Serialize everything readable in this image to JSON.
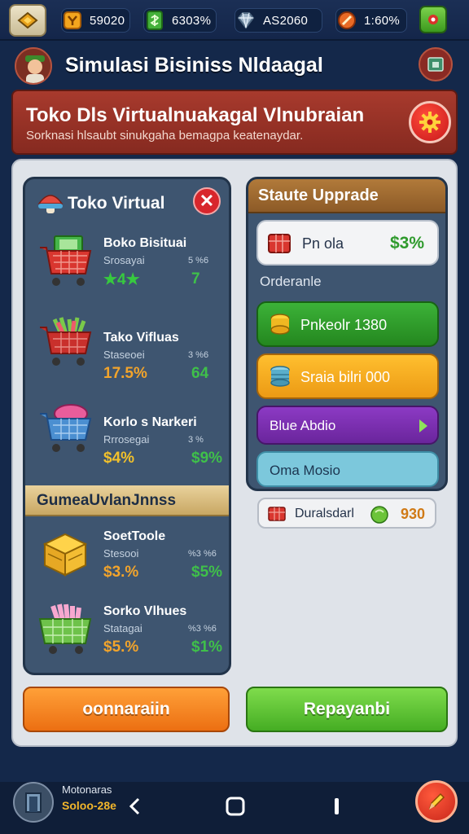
{
  "topbar": {
    "stats": [
      {
        "icon": "trophy-icon",
        "value": "59020"
      },
      {
        "icon": "cash-icon",
        "value": "6303%"
      },
      {
        "icon": "gem-icon",
        "value": "AS2060"
      },
      {
        "icon": "rocket-icon",
        "value": "1:60%"
      }
    ]
  },
  "header": {
    "title": "Simulasi Bisiniss Nldaagal"
  },
  "banner": {
    "title": "Toko Dls Virtualnuakagal Vlnubraian",
    "subtitle": "Sorknasi hlsaubt sinukgaha bemagpa keatenaydar."
  },
  "store_panel": {
    "title": "Toko Virtual",
    "close_label": "✕",
    "items": [
      {
        "name": "Boko Bisituai",
        "sub": "Srosayai",
        "small": "5 %6",
        "v1": "★4★",
        "v2": "7",
        "v1_color": "#37c93f"
      },
      {
        "name": "Tako Vifluas",
        "sub": "Staseoei",
        "small": "3 %6",
        "v1": "17.5%",
        "v2": "64",
        "v1_color": "#f2a42b"
      },
      {
        "name": "Korlo s Narkeri",
        "sub": "Rrrosegai",
        "small": "3 %",
        "v1": "$4%",
        "v2": "$9%",
        "v1_color": "#f2c12b"
      }
    ],
    "section_title": "GumeaUvlanJnnss",
    "section_items": [
      {
        "name": "SoetToole",
        "sub": "Stesooi",
        "small": "%3 %6",
        "v1": "$3.%",
        "v2": "$5%",
        "v1_color": "#f2a42b"
      },
      {
        "name": "Sorko Vlhues",
        "sub": "Statagai",
        "small": "%3 %6",
        "v1": "$5.%",
        "v2": "$1%",
        "v1_color": "#f2a42b"
      }
    ]
  },
  "upgrade_panel": {
    "title": "Staute Upprade",
    "top_item": {
      "label": "Pn ola",
      "value": "$3%"
    },
    "order_label": "Orderanle",
    "options": [
      {
        "label": "Pnkeolr 1380",
        "color": "#2e9a2d"
      },
      {
        "label": "Sraia bilri 000",
        "color": "#f0a21f"
      },
      {
        "label": "Blue Abdio",
        "color": "#7a2fb0"
      },
      {
        "label": "Oma Mosio",
        "color": "#5cb8d6"
      }
    ],
    "chip": {
      "label": "Duralsdarl",
      "value": "930"
    }
  },
  "buttons": {
    "left": "oonnaraiin",
    "right": "Repayanbi"
  },
  "bottom": {
    "label1": "Motonaras",
    "label2": "Soloo-28e"
  }
}
